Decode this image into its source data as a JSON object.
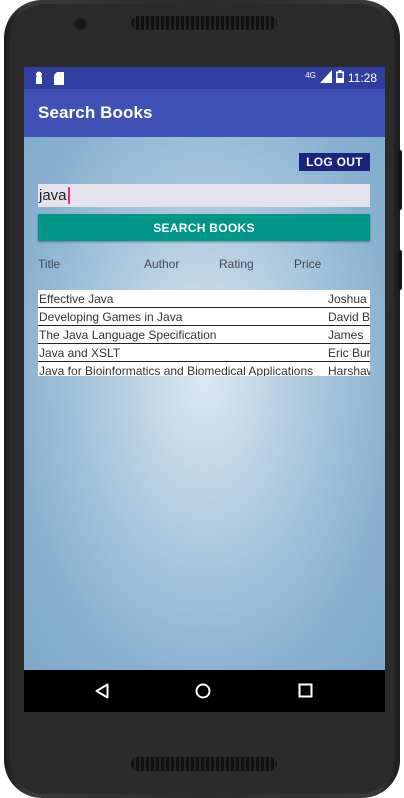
{
  "status_bar": {
    "network": "4G",
    "time": "11:28",
    "icons": [
      "notification-icon",
      "sd-card-icon",
      "signal-icon",
      "battery-icon"
    ]
  },
  "app_bar": {
    "title": "Search Books"
  },
  "actions": {
    "logout_label": "LOG OUT",
    "search_label": "SEARCH BOOKS"
  },
  "search": {
    "value": "java"
  },
  "table": {
    "headers": [
      "Title",
      "Author",
      "Rating",
      "Price"
    ],
    "rows": [
      {
        "title": "Effective Java",
        "author": "Joshua"
      },
      {
        "title": "Developing Games in Java",
        "author": "David B"
      },
      {
        "title": "The Java Language Specification",
        "author": "James"
      },
      {
        "title": "Java and XSLT",
        "author": "Eric Bur"
      },
      {
        "title": "Java for Bioinformatics and Biomedical Applications",
        "author": "Harshaw"
      }
    ]
  },
  "nav": {
    "icons": [
      "back-icon",
      "home-icon",
      "recents-icon"
    ]
  },
  "colors": {
    "status_bar": "#303f9f",
    "app_bar": "#3f51b5",
    "logout_button": "#1a237e",
    "search_button": "#009688",
    "caret": "#e5307a"
  }
}
